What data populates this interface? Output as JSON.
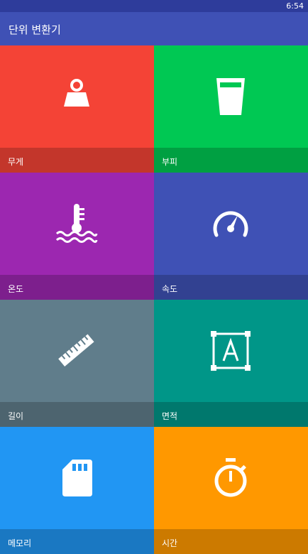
{
  "status_bar": {
    "time": "6:54"
  },
  "app_bar": {
    "title": "단위 변환기"
  },
  "tiles": [
    {
      "label": "무게",
      "icon": "weight-icon",
      "color": "#f44336",
      "band_color": "#c3362b"
    },
    {
      "label": "부피",
      "icon": "cup-icon",
      "color": "#00c853",
      "band_color": "#00a042"
    },
    {
      "label": "온도",
      "icon": "thermometer-icon",
      "color": "#9c27b0",
      "band_color": "#7d1f8d"
    },
    {
      "label": "속도",
      "icon": "speedometer-icon",
      "color": "#3f51b5",
      "band_color": "#324191"
    },
    {
      "label": "길이",
      "icon": "ruler-icon",
      "color": "#607d8b",
      "band_color": "#4d646f"
    },
    {
      "label": "면적",
      "icon": "area-icon",
      "color": "#009688",
      "band_color": "#00786d"
    },
    {
      "label": "메모리",
      "icon": "sd-card-icon",
      "color": "#2196f3",
      "band_color": "#1a78c2"
    },
    {
      "label": "시간",
      "icon": "stopwatch-icon",
      "color": "#ff9800",
      "band_color": "#cc7a00"
    }
  ]
}
